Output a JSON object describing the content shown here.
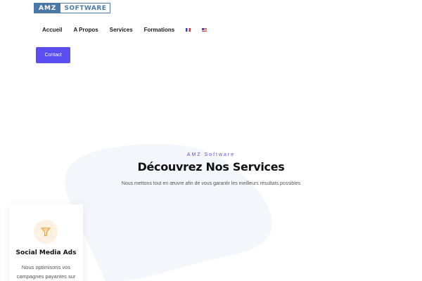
{
  "header": {
    "logo": {
      "part1": "AMZ",
      "part2": "SOFTWARE"
    },
    "nav": [
      {
        "label": "Accueil"
      },
      {
        "label": "A Propos"
      },
      {
        "label": "Services"
      },
      {
        "label": "Formations"
      }
    ],
    "languages": [
      "flag-fr-icon",
      "flag-us-icon"
    ],
    "contact_label": "Contact"
  },
  "services_section": {
    "eyebrow": "AMZ Software",
    "heading": "Découvrez Nos Services",
    "subtext": "Nous mettons tout en œuvre afin de vous garantir les meilleurs résultats possibles",
    "cards": [
      {
        "icon": "funnel-icon",
        "title": "Social Media Ads",
        "desc_line1": "Nous optimisons vos",
        "desc_line2": "campagnes payantes sur"
      }
    ]
  },
  "colors": {
    "accent": "#5b4ef0",
    "logo_blue": "#4a79a8",
    "icon_orange": "#f0a030",
    "icon_bg": "#fdf1e2",
    "blob": "#f5f6fb"
  }
}
